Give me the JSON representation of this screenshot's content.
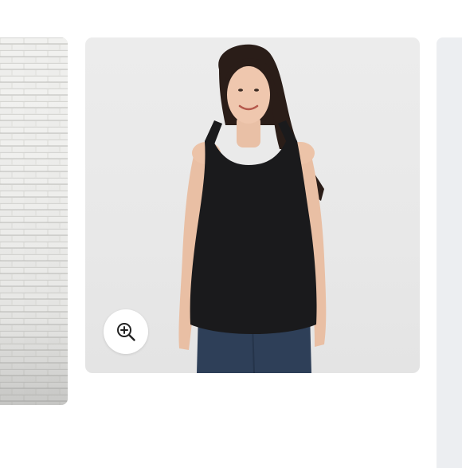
{
  "gallery": {
    "slides": [
      {
        "name": "previous-slide",
        "image": "brick-wall-photo"
      },
      {
        "name": "current-slide",
        "image": "model-black-tank-top-photo"
      },
      {
        "name": "next-slide",
        "image": "light-background-photo"
      }
    ],
    "zoom_button": {
      "icon": "zoom-in-icon",
      "label": ""
    }
  },
  "colors": {
    "page_background": "#ffffff",
    "slide_background": "#eaeaea",
    "tank_top": "#1a1a1c",
    "jeans": "#2e3f58",
    "zoom_icon": "#222222"
  }
}
